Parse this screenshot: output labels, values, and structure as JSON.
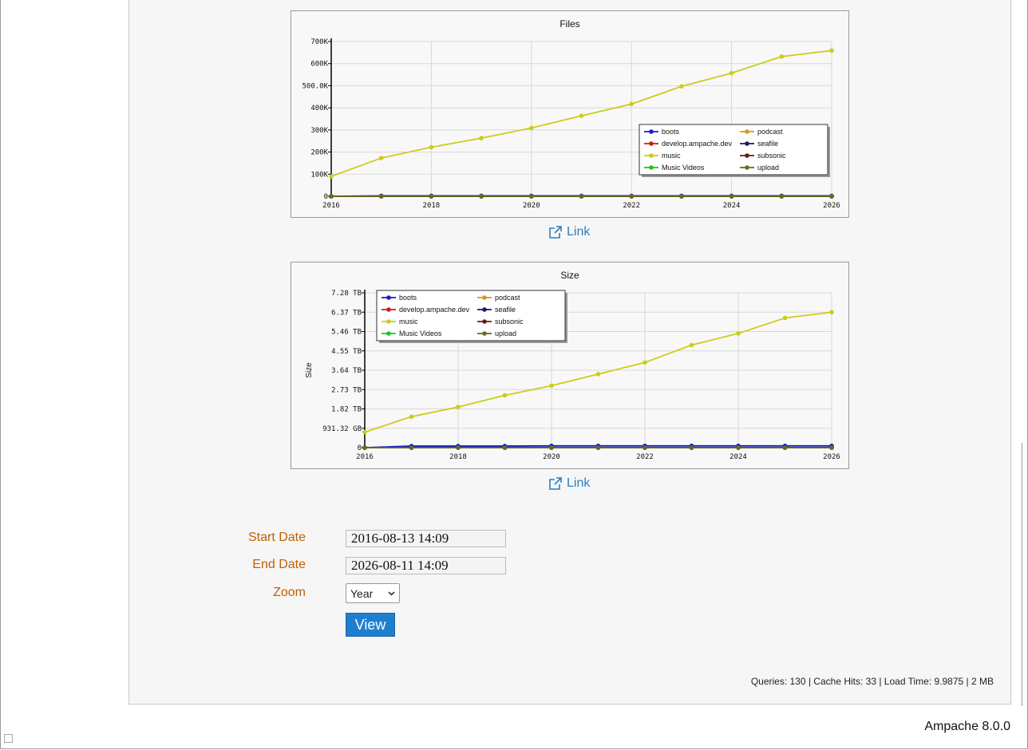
{
  "links": {
    "files_link": "Link",
    "size_link": "Link"
  },
  "form": {
    "start_label": "Start Date",
    "start_value": "2016-08-13 14:09",
    "end_label": "End Date",
    "end_value": "2026-08-11 14:09",
    "zoom_label": "Zoom",
    "zoom_value": "Year",
    "view_label": "View"
  },
  "footer": {
    "stats": "Queries: 130 | Cache Hits: 33 | Load Time: 9.9875 | 2 MB",
    "version": "Ampache 8.0.0"
  },
  "colors": {
    "boots": "#1a1ad0",
    "develop.ampache.dev": "#d01a1a",
    "music": "#cccc1a",
    "Music Videos": "#1ac81a",
    "podcast": "#d09a1a",
    "seafile": "#1a1a6a",
    "subsonic": "#6a1a1a",
    "upload": "#6a6a1a"
  },
  "chart_data": [
    {
      "type": "line",
      "title": "Files",
      "ylabel": "",
      "x": [
        2016,
        2017,
        2018,
        2019,
        2020,
        2021,
        2022,
        2023,
        2024,
        2025,
        2026
      ],
      "xticks": [
        "2016",
        "2018",
        "2020",
        "2022",
        "2024",
        "2026"
      ],
      "yticks": [
        "0",
        "100K",
        "200K",
        "300K",
        "400K",
        "500.0K",
        "600K",
        "700K"
      ],
      "ylim": [
        0,
        700000
      ],
      "legend_position": "center-right",
      "series": [
        {
          "name": "boots",
          "values": [
            0,
            2000,
            2000,
            2000,
            2000,
            2000,
            2000,
            2000,
            2000,
            2000,
            2000
          ]
        },
        {
          "name": "develop.ampache.dev",
          "values": [
            0,
            0,
            0,
            0,
            0,
            0,
            0,
            0,
            0,
            0,
            0
          ]
        },
        {
          "name": "music",
          "values": [
            90000,
            173000,
            222000,
            263000,
            309000,
            364000,
            417000,
            497000,
            557000,
            632000,
            659000
          ]
        },
        {
          "name": "Music Videos",
          "values": [
            0,
            0,
            0,
            0,
            0,
            0,
            0,
            0,
            0,
            0,
            0
          ]
        },
        {
          "name": "podcast",
          "values": [
            0,
            0,
            0,
            0,
            0,
            0,
            0,
            0,
            0,
            0,
            0
          ]
        },
        {
          "name": "seafile",
          "values": [
            0,
            0,
            0,
            0,
            0,
            0,
            0,
            0,
            0,
            0,
            0
          ]
        },
        {
          "name": "subsonic",
          "values": [
            0,
            0,
            0,
            0,
            0,
            0,
            0,
            0,
            0,
            0,
            0
          ]
        },
        {
          "name": "upload",
          "values": [
            0,
            0,
            0,
            0,
            0,
            0,
            0,
            0,
            0,
            0,
            0
          ]
        }
      ]
    },
    {
      "type": "line",
      "title": "Size",
      "ylabel": "Size",
      "x": [
        2016,
        2017,
        2018,
        2019,
        2020,
        2021,
        2022,
        2023,
        2024,
        2025,
        2026
      ],
      "xticks": [
        "2016",
        "2018",
        "2020",
        "2022",
        "2024",
        "2026"
      ],
      "yticks": [
        "0",
        "931.32 GB",
        "1.82 TB",
        "2.73 TB",
        "3.64 TB",
        "4.55 TB",
        "5.46 TB",
        "6.37 TB",
        "7.28 TB"
      ],
      "ylim": [
        0,
        8
      ],
      "ytick_unit": "931.32 GB",
      "legend_position": "top-left",
      "series": [
        {
          "name": "boots",
          "values": [
            0,
            0.08,
            0.08,
            0.08,
            0.09,
            0.09,
            0.09,
            0.09,
            0.09,
            0.09,
            0.09
          ]
        },
        {
          "name": "develop.ampache.dev",
          "values": [
            0,
            0,
            0,
            0,
            0,
            0,
            0,
            0,
            0,
            0,
            0
          ]
        },
        {
          "name": "music",
          "values": [
            0.8,
            1.6,
            2.1,
            2.7,
            3.2,
            3.8,
            4.4,
            5.3,
            5.9,
            6.7,
            7.0
          ]
        },
        {
          "name": "Music Videos",
          "values": [
            0,
            0,
            0,
            0,
            0,
            0,
            0,
            0,
            0,
            0,
            0
          ]
        },
        {
          "name": "podcast",
          "values": [
            0,
            0,
            0,
            0,
            0,
            0,
            0,
            0,
            0,
            0,
            0
          ]
        },
        {
          "name": "seafile",
          "values": [
            0,
            0,
            0,
            0,
            0,
            0,
            0,
            0,
            0,
            0,
            0
          ]
        },
        {
          "name": "subsonic",
          "values": [
            0,
            0,
            0,
            0,
            0,
            0,
            0,
            0,
            0,
            0,
            0
          ]
        },
        {
          "name": "upload",
          "values": [
            0,
            0,
            0,
            0,
            0,
            0,
            0,
            0,
            0,
            0,
            0
          ]
        }
      ]
    }
  ]
}
